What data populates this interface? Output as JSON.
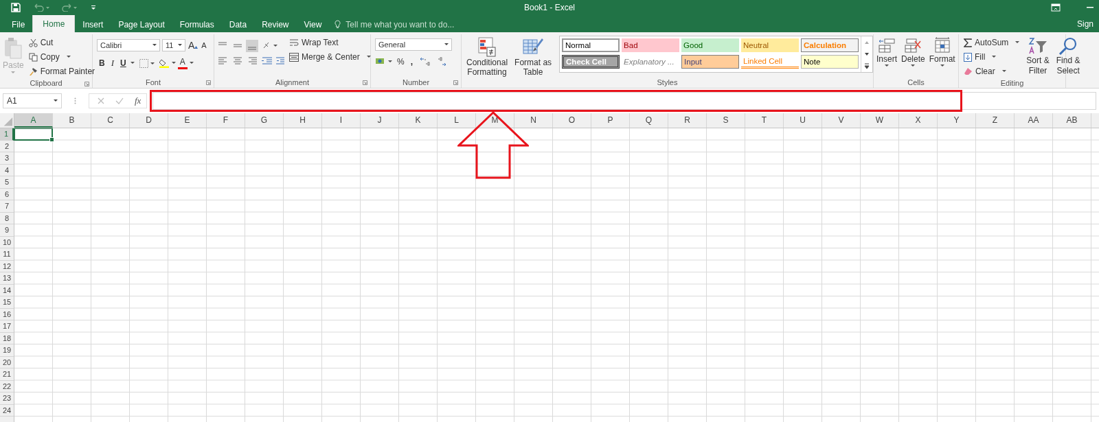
{
  "window": {
    "title": "Book1 - Excel"
  },
  "tabs": [
    {
      "label": "File",
      "selected": false
    },
    {
      "label": "Home",
      "selected": true
    },
    {
      "label": "Insert",
      "selected": false
    },
    {
      "label": "Page Layout",
      "selected": false
    },
    {
      "label": "Formulas",
      "selected": false
    },
    {
      "label": "Data",
      "selected": false
    },
    {
      "label": "Review",
      "selected": false
    },
    {
      "label": "View",
      "selected": false
    }
  ],
  "tell_me": {
    "placeholder": "Tell me what you want to do..."
  },
  "account": {
    "label": "Sign"
  },
  "clipboard": {
    "title": "Clipboard",
    "paste": {
      "label": "Paste",
      "disabled": true
    },
    "cut": "Cut",
    "copy": "Copy",
    "format_painter": "Format Painter"
  },
  "font": {
    "title": "Font",
    "name": "Calibri",
    "size": "11",
    "grow": "A",
    "shrink": "A",
    "bold": "B",
    "italic": "I",
    "underline": "U",
    "font_color": "A"
  },
  "alignment": {
    "title": "Alignment",
    "wrap_text": "Wrap Text",
    "merge": "Merge & Center"
  },
  "number": {
    "title": "Number",
    "format": "General",
    "percent": "%",
    "comma": ","
  },
  "conditional": {
    "lines": [
      "Conditional",
      "Formatting"
    ]
  },
  "format_table": {
    "lines": [
      "Format as",
      "Table"
    ]
  },
  "styles": {
    "title": "Styles",
    "cells": [
      {
        "label": "Normal",
        "kind": "normal"
      },
      {
        "label": "Bad",
        "kind": "bad"
      },
      {
        "label": "Good",
        "kind": "good"
      },
      {
        "label": "Neutral",
        "kind": "neutral"
      },
      {
        "label": "Calculation",
        "kind": "calculation"
      },
      {
        "label": "Check Cell",
        "kind": "check"
      },
      {
        "label": "Explanatory ...",
        "kind": "explanatory"
      },
      {
        "label": "Input",
        "kind": "input"
      },
      {
        "label": "Linked Cell",
        "kind": "linked"
      },
      {
        "label": "Note",
        "kind": "note"
      }
    ]
  },
  "cells": {
    "title": "Cells",
    "insert": "Insert",
    "delete": "Delete",
    "format": "Format"
  },
  "editing": {
    "title": "Editing",
    "autosum": "AutoSum",
    "fill": "Fill",
    "clear": "Clear",
    "sort": [
      "Sort &",
      "Filter"
    ],
    "find": [
      "Find &",
      "Select"
    ]
  },
  "formula_bar": {
    "name_box": "A1",
    "fx": "fx"
  },
  "sheet": {
    "columns": [
      {
        "label": "A",
        "selected": true
      },
      {
        "label": "B",
        "selected": false
      },
      {
        "label": "C",
        "selected": false
      },
      {
        "label": "D",
        "selected": false
      },
      {
        "label": "E",
        "selected": false
      },
      {
        "label": "F",
        "selected": false
      },
      {
        "label": "G",
        "selected": false
      },
      {
        "label": "H",
        "selected": false
      },
      {
        "label": "I",
        "selected": false
      },
      {
        "label": "J",
        "selected": false
      },
      {
        "label": "K",
        "selected": false
      },
      {
        "label": "L",
        "selected": false
      },
      {
        "label": "M",
        "selected": false
      },
      {
        "label": "N",
        "selected": false
      },
      {
        "label": "O",
        "selected": false
      },
      {
        "label": "P",
        "selected": false
      },
      {
        "label": "Q",
        "selected": false
      },
      {
        "label": "R",
        "selected": false
      },
      {
        "label": "S",
        "selected": false
      },
      {
        "label": "T",
        "selected": false
      },
      {
        "label": "U",
        "selected": false
      },
      {
        "label": "V",
        "selected": false
      },
      {
        "label": "W",
        "selected": false
      },
      {
        "label": "X",
        "selected": false
      },
      {
        "label": "Y",
        "selected": false
      },
      {
        "label": "Z",
        "selected": false
      },
      {
        "label": "AA",
        "selected": false
      },
      {
        "label": "AB",
        "selected": false
      }
    ],
    "rows": [
      {
        "label": "1",
        "selected": true
      },
      {
        "label": "2",
        "selected": false
      },
      {
        "label": "3",
        "selected": false
      },
      {
        "label": "4",
        "selected": false
      },
      {
        "label": "5",
        "selected": false
      },
      {
        "label": "6",
        "selected": false
      },
      {
        "label": "7",
        "selected": false
      },
      {
        "label": "8",
        "selected": false
      },
      {
        "label": "9",
        "selected": false
      },
      {
        "label": "10",
        "selected": false
      },
      {
        "label": "11",
        "selected": false
      },
      {
        "label": "12",
        "selected": false
      },
      {
        "label": "13",
        "selected": false
      },
      {
        "label": "14",
        "selected": false
      },
      {
        "label": "15",
        "selected": false
      },
      {
        "label": "16",
        "selected": false
      },
      {
        "label": "17",
        "selected": false
      },
      {
        "label": "18",
        "selected": false
      },
      {
        "label": "19",
        "selected": false
      },
      {
        "label": "20",
        "selected": false
      },
      {
        "label": "21",
        "selected": false
      },
      {
        "label": "22",
        "selected": false
      },
      {
        "label": "23",
        "selected": false
      },
      {
        "label": "24",
        "selected": false
      }
    ]
  }
}
